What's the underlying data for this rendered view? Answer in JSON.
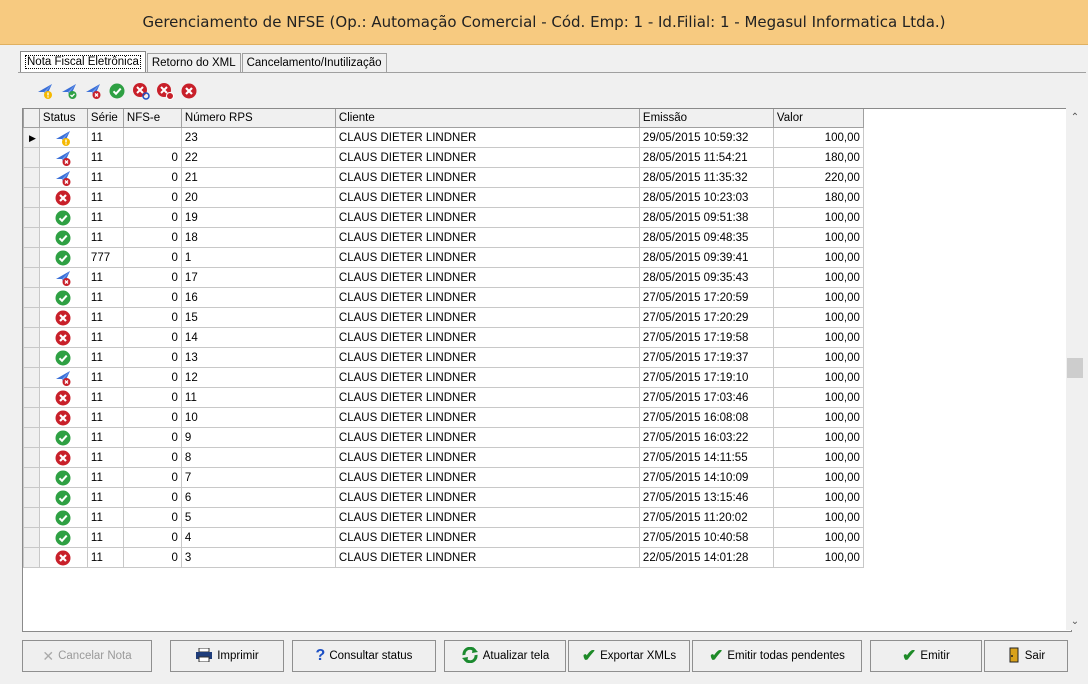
{
  "window": {
    "title": "Gerenciamento de NFSE (Op.: Automação Comercial - Cód. Emp: 1 - Id.Filial: 1 - Megasul Informatica Ltda.)"
  },
  "tabs": [
    {
      "label": "Nota Fiscal Eletrônica",
      "active": true
    },
    {
      "label": "Retorno do XML",
      "active": false
    },
    {
      "label": "Cancelamento/Inutilização",
      "active": false
    }
  ],
  "toolbar": {
    "icons": [
      "plane-warning-icon",
      "plane-ok-icon",
      "plane-error-icon",
      "ok-circle-icon",
      "error-search-icon",
      "error-delete-icon",
      "error-circle-icon"
    ]
  },
  "grid": {
    "columns": [
      "Status",
      "Série",
      "NFS-e",
      "Número RPS",
      "Cliente",
      "Emissão",
      "Valor"
    ],
    "rows": [
      {
        "status": "pending",
        "serie": "11",
        "nfse": "",
        "rps": "23",
        "cliente": "CLAUS DIETER LINDNER",
        "emissao": "29/05/2015 10:59:32",
        "valor": "100,00"
      },
      {
        "status": "sent-error",
        "serie": "11",
        "nfse": "0",
        "rps": "22",
        "cliente": "CLAUS DIETER LINDNER",
        "emissao": "28/05/2015 11:54:21",
        "valor": "180,00"
      },
      {
        "status": "sent-error",
        "serie": "11",
        "nfse": "0",
        "rps": "21",
        "cliente": "CLAUS DIETER LINDNER",
        "emissao": "28/05/2015 11:35:32",
        "valor": "220,00"
      },
      {
        "status": "error",
        "serie": "11",
        "nfse": "0",
        "rps": "20",
        "cliente": "CLAUS DIETER LINDNER",
        "emissao": "28/05/2015 10:23:03",
        "valor": "180,00"
      },
      {
        "status": "ok",
        "serie": "11",
        "nfse": "0",
        "rps": "19",
        "cliente": "CLAUS DIETER LINDNER",
        "emissao": "28/05/2015 09:51:38",
        "valor": "100,00"
      },
      {
        "status": "ok",
        "serie": "11",
        "nfse": "0",
        "rps": "18",
        "cliente": "CLAUS DIETER LINDNER",
        "emissao": "28/05/2015 09:48:35",
        "valor": "100,00"
      },
      {
        "status": "ok",
        "serie": "777",
        "nfse": "0",
        "rps": "1",
        "cliente": "CLAUS DIETER LINDNER",
        "emissao": "28/05/2015 09:39:41",
        "valor": "100,00"
      },
      {
        "status": "sent-error",
        "serie": "11",
        "nfse": "0",
        "rps": "17",
        "cliente": "CLAUS DIETER LINDNER",
        "emissao": "28/05/2015 09:35:43",
        "valor": "100,00"
      },
      {
        "status": "ok",
        "serie": "11",
        "nfse": "0",
        "rps": "16",
        "cliente": "CLAUS DIETER LINDNER",
        "emissao": "27/05/2015 17:20:59",
        "valor": "100,00"
      },
      {
        "status": "error",
        "serie": "11",
        "nfse": "0",
        "rps": "15",
        "cliente": "CLAUS DIETER LINDNER",
        "emissao": "27/05/2015 17:20:29",
        "valor": "100,00"
      },
      {
        "status": "error",
        "serie": "11",
        "nfse": "0",
        "rps": "14",
        "cliente": "CLAUS DIETER LINDNER",
        "emissao": "27/05/2015 17:19:58",
        "valor": "100,00"
      },
      {
        "status": "ok",
        "serie": "11",
        "nfse": "0",
        "rps": "13",
        "cliente": "CLAUS DIETER LINDNER",
        "emissao": "27/05/2015 17:19:37",
        "valor": "100,00"
      },
      {
        "status": "sent-error",
        "serie": "11",
        "nfse": "0",
        "rps": "12",
        "cliente": "CLAUS DIETER LINDNER",
        "emissao": "27/05/2015 17:19:10",
        "valor": "100,00"
      },
      {
        "status": "error",
        "serie": "11",
        "nfse": "0",
        "rps": "11",
        "cliente": "CLAUS DIETER LINDNER",
        "emissao": "27/05/2015 17:03:46",
        "valor": "100,00"
      },
      {
        "status": "error",
        "serie": "11",
        "nfse": "0",
        "rps": "10",
        "cliente": "CLAUS DIETER LINDNER",
        "emissao": "27/05/2015 16:08:08",
        "valor": "100,00"
      },
      {
        "status": "ok",
        "serie": "11",
        "nfse": "0",
        "rps": "9",
        "cliente": "CLAUS DIETER LINDNER",
        "emissao": "27/05/2015 16:03:22",
        "valor": "100,00"
      },
      {
        "status": "error",
        "serie": "11",
        "nfse": "0",
        "rps": "8",
        "cliente": "CLAUS DIETER LINDNER",
        "emissao": "27/05/2015 14:11:55",
        "valor": "100,00"
      },
      {
        "status": "ok",
        "serie": "11",
        "nfse": "0",
        "rps": "7",
        "cliente": "CLAUS DIETER LINDNER",
        "emissao": "27/05/2015 14:10:09",
        "valor": "100,00"
      },
      {
        "status": "ok",
        "serie": "11",
        "nfse": "0",
        "rps": "6",
        "cliente": "CLAUS DIETER LINDNER",
        "emissao": "27/05/2015 13:15:46",
        "valor": "100,00"
      },
      {
        "status": "ok",
        "serie": "11",
        "nfse": "0",
        "rps": "5",
        "cliente": "CLAUS DIETER LINDNER",
        "emissao": "27/05/2015 11:20:02",
        "valor": "100,00"
      },
      {
        "status": "ok",
        "serie": "11",
        "nfse": "0",
        "rps": "4",
        "cliente": "CLAUS DIETER LINDNER",
        "emissao": "27/05/2015 10:40:58",
        "valor": "100,00"
      },
      {
        "status": "error",
        "serie": "11",
        "nfse": "0",
        "rps": "3",
        "cliente": "CLAUS DIETER LINDNER",
        "emissao": "22/05/2015 14:01:28",
        "valor": "100,00"
      }
    ]
  },
  "buttons": {
    "cancelar": "Cancelar Nota",
    "imprimir": "Imprimir",
    "consultar": "Consultar status",
    "atualizar": "Atualizar tela",
    "exportar": "Exportar XMLs",
    "emitir_todas": "Emitir todas pendentes",
    "emitir": "Emitir",
    "sair": "Sair"
  },
  "colors": {
    "title_bg": "#f7ca80",
    "ok": "#2ea043",
    "error": "#c8202a",
    "plane": "#3a6fd8",
    "warning": "#f5b800"
  }
}
